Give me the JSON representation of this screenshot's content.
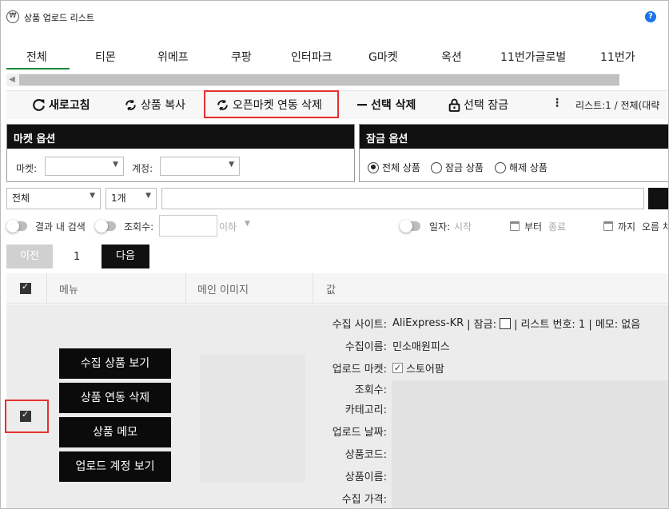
{
  "titlebar": {
    "app_icon": "₩",
    "title": "상품 업로드 리스트",
    "help": "?"
  },
  "tabs": [
    "전체",
    "티몬",
    "위메프",
    "쿠팡",
    "인터파크",
    "G마켓",
    "옥션",
    "11번가글로벌",
    "11번가"
  ],
  "toolbar": {
    "refresh": "새로고침",
    "copy": "상품 복사",
    "unlink": "오픈마켓 연동 삭제",
    "delete_selected": "선택 삭제",
    "lock_selected": "선택 잠금",
    "more": "⋮",
    "info": "리스트:1  /  전체(대략"
  },
  "market_options": {
    "title": "마켓 옵션",
    "market_label": "마켓:",
    "account_label": "계정:"
  },
  "lock_options": {
    "title": "잠금 옵션",
    "radios": [
      "전체 상품",
      "잠금 상품",
      "해제 상품"
    ]
  },
  "search": {
    "scope": "전체",
    "count": "1개"
  },
  "filters": {
    "within": "결과 내 검색",
    "views": "조회수:",
    "below": "이하",
    "date": "일자:",
    "start_ph": "시작",
    "from": "부터",
    "end_ph": "종료",
    "until": "까지",
    "sort": "오름 차"
  },
  "pagination": {
    "prev": "이전",
    "page": "1",
    "next": "다음"
  },
  "table": {
    "headers": [
      "메뉴",
      "메인 이미지",
      "값"
    ],
    "actions": [
      "수집 상품 보기",
      "상품 연동 삭제",
      "상품 메모",
      "업로드 계정 보기"
    ],
    "fields": {
      "site_label": "수집 사이트:",
      "site_value": "AliExpress-KR",
      "lock_label": "| 잠금:",
      "list_no": "| 리스트 번호: 1 | 메모: 없음",
      "name_label": "수집이름:",
      "name_value": "민소매원피스",
      "market_label": "업로드 마켓:",
      "market_value": "스토어팜",
      "views_label": "조회수:",
      "category_label": "카테고리:",
      "date_label": "업로드 날짜:",
      "code_label": "상품코드:",
      "pname_label": "상품이름:",
      "price_label": "수집 가격:"
    }
  }
}
